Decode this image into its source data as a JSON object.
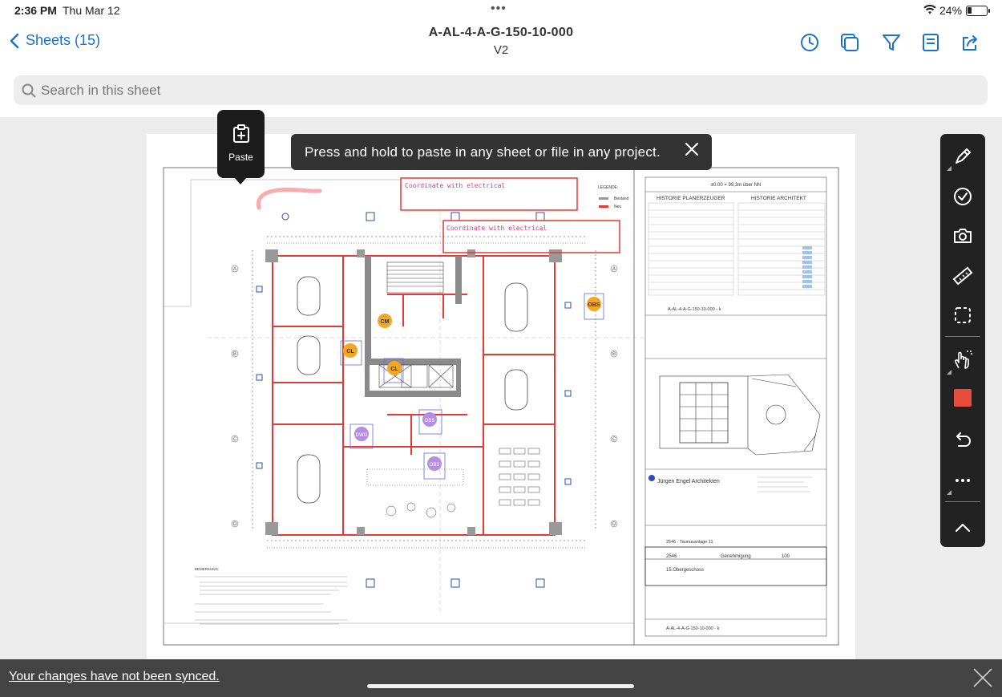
{
  "status_bar": {
    "time": "2:36 PM",
    "date": "Thu Mar 12",
    "battery": "24%",
    "battery_level": 0.24
  },
  "nav": {
    "back_label": "Sheets (15)",
    "title": "A-AL-4-A-G-150-10-000",
    "version": "V2",
    "icons": [
      "history-icon",
      "layers-icon",
      "filter-icon",
      "save-icon",
      "share-icon"
    ]
  },
  "search": {
    "placeholder": "Search in this sheet"
  },
  "paste_popup": {
    "label": "Paste",
    "icon": "clipboard-plus-icon"
  },
  "toast": {
    "message": "Press and hold to paste in any sheet or file in any project."
  },
  "drawing": {
    "markups": [
      "Coordinate with electrical",
      "Coordinate with electrical"
    ],
    "pins": [
      "OBS",
      "CM",
      "CL",
      "CL",
      "DWG",
      "OBS",
      "OBS"
    ],
    "legend_title": "LEGENDE:",
    "legend_items": [
      "Bestand",
      "Neu"
    ],
    "elevation": "±0.00 = 99,3m über NN",
    "history_left": "HISTORIE PLANERZEUGER",
    "history_right": "HISTORIE ARCHITEKT",
    "sheet_id_top": "A-AL-4-A-G-150-10-000 - k",
    "architect": "Jürgen Engel Architekten",
    "project": "2546 - Taunusanlage 11",
    "phase_code": "2546",
    "phase": "Genehmigung",
    "scale": "100",
    "floor": "15.Obergeschoss",
    "sheet_id_bottom": "A-AL-4-A-G-150-10-000 - k",
    "notes_title": "BEMERKUNG:"
  },
  "toolbar": {
    "tools": [
      "pen-icon",
      "checkmark-icon",
      "camera-icon",
      "ruler-icon",
      "select-area-icon",
      "hand-icon",
      "color-swatch",
      "undo-icon",
      "more-icon",
      "collapse-icon"
    ],
    "color": "#e84c3d"
  },
  "sync_bar": {
    "message": "Your changes have not been synced."
  },
  "colors": {
    "accent": "#1a73c9",
    "markup": "#e53935",
    "pin_orange": "#f5a623",
    "pin_purple": "#b48ee0"
  }
}
